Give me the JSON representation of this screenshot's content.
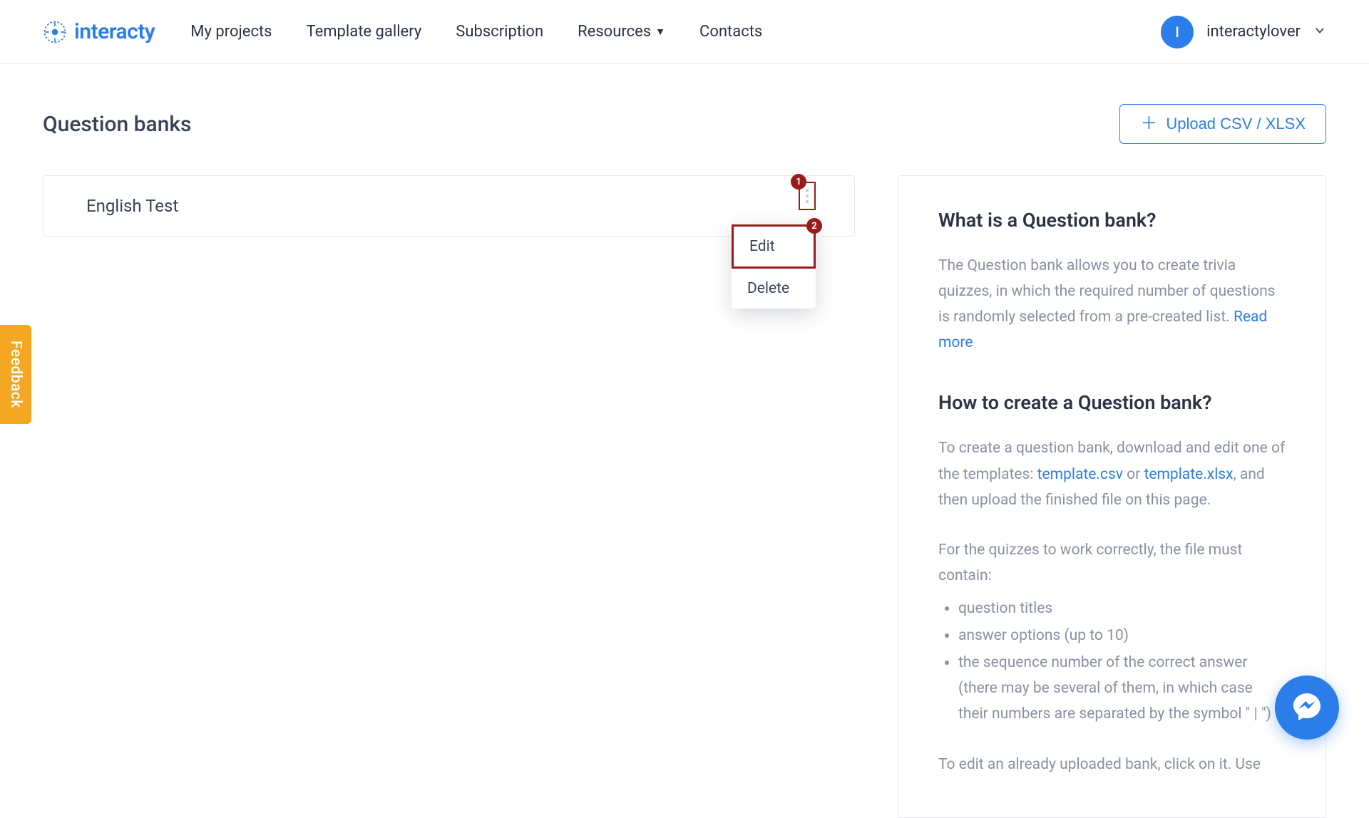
{
  "brand": "interacty",
  "nav": {
    "my_projects": "My projects",
    "template_gallery": "Template gallery",
    "subscription": "Subscription",
    "resources": "Resources",
    "contacts": "Contacts"
  },
  "user": {
    "initial": "I",
    "name": "interactylover"
  },
  "page": {
    "title": "Question banks",
    "upload_btn": "Upload CSV / XLSX"
  },
  "banks": [
    {
      "name": "English Test"
    }
  ],
  "menu": {
    "edit": "Edit",
    "delete": "Delete"
  },
  "annotations": {
    "one": "1",
    "two": "2"
  },
  "info": {
    "h1": "What is a Question bank?",
    "p1a": "The Question bank allows you to create trivia quizzes, in which the required number of questions is randomly selected from a pre-created list. ",
    "read_more": "Read more",
    "h2": "How to create a Question bank?",
    "p2a": "To create a question bank, download and edit one of the templates: ",
    "tmpl_csv": "template.csv",
    "or": " or ",
    "tmpl_xlsx": "template.xlsx",
    "p2b": ", and then upload the finished file on this page.",
    "p3": "For the quizzes to work correctly, the file must contain:",
    "li1": "question titles",
    "li2": "answer options (up to 10)",
    "li3": "the sequence number of the correct answer (there may be several of them, in which case their numbers are separated by the symbol \" | \")",
    "p4": "To edit an already uploaded bank, click on it. Use"
  },
  "feedback": "Feedback"
}
